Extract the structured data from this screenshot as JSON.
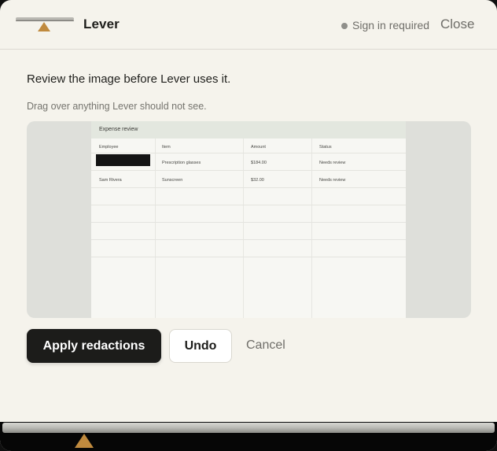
{
  "app": {
    "name": "Lever",
    "sign_in_status": "Sign in required",
    "close_label": "Close"
  },
  "dialog": {
    "heading": "Review the image before Lever uses it.",
    "hint": "Drag over anything Lever should not see."
  },
  "preview": {
    "sheet_title": "Expense review",
    "columns": [
      "Employee",
      "Item",
      "Amount",
      "Status"
    ],
    "rows": [
      [
        "",
        "Prescription glasses",
        "$184.00",
        "Needs review"
      ],
      [
        "Sam Rivera",
        "Sunscreen",
        "$32.00",
        "Needs review"
      ]
    ],
    "redacted_cells": 1
  },
  "actions": {
    "apply_label": "Apply redactions",
    "undo_label": "Undo",
    "cancel_label": "Cancel"
  },
  "colors": {
    "accent_marker": "#c08a3e",
    "primary_button": "#1c1c1a",
    "background": "#f5f3ec"
  },
  "icons": {
    "logo": "balance-lever-icon",
    "status": "status-dot-icon",
    "bottom": "triangle-marker-icon"
  }
}
